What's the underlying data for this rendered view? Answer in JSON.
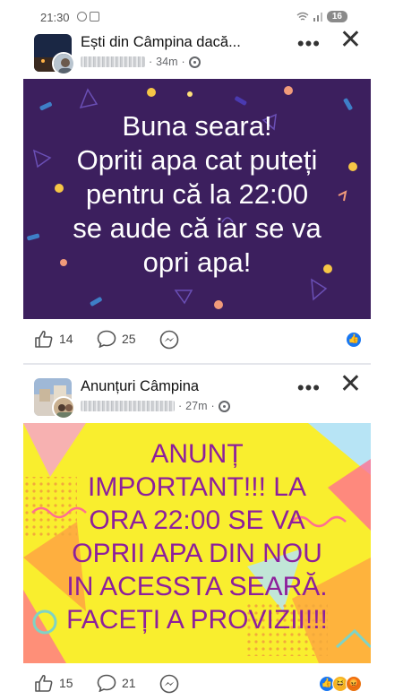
{
  "status_bar": {
    "time": "21:30",
    "battery": "16"
  },
  "posts": [
    {
      "title": "Ești din Câmpina dacă...",
      "time_ago": "34m",
      "more_label": "•••",
      "close_label": "✕",
      "card_lines": [
        "Buna seara!",
        "Opriti apa cat puteți",
        "pentru că la 22:00",
        "se aude că iar se va",
        "opri apa!"
      ],
      "card_colors": {
        "background": "#3c1f5e",
        "text": "#ffffff"
      },
      "likes": "14",
      "comments": "25",
      "reactions": [
        "like"
      ]
    },
    {
      "title": "Anunțuri Câmpina",
      "time_ago": "27m",
      "more_label": "•••",
      "close_label": "✕",
      "card_lines": [
        "ANUNȚ",
        "IMPORTANT!!! LA",
        "ORA 22:00 SE VA",
        "OPRII APA DIN NOU",
        "IN ACESSTA SEARĂ.",
        "FACEȚI A PROVIZII!!!"
      ],
      "card_colors": {
        "background": "#f9ee2e",
        "text": "#8d1f9c"
      },
      "likes": "15",
      "comments": "21",
      "reactions": [
        "like",
        "haha",
        "angry"
      ]
    }
  ]
}
